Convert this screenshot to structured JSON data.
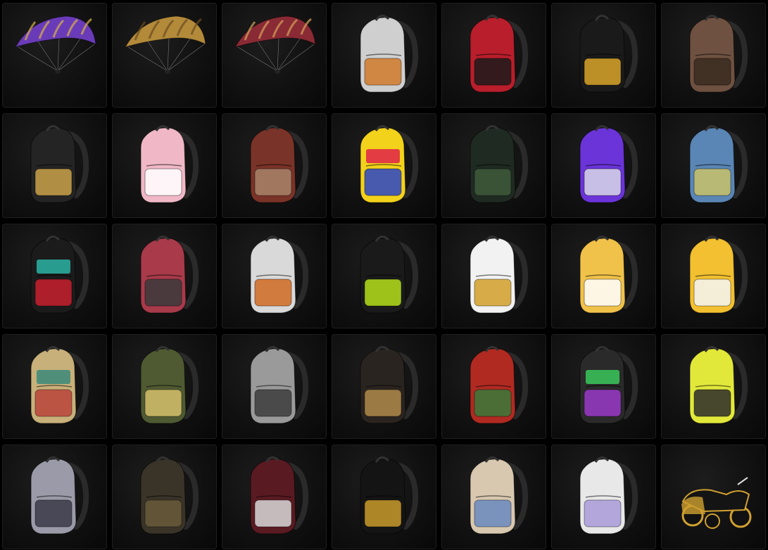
{
  "inventory": {
    "items": [
      {
        "id": "purple-parachute",
        "kind": "parachute",
        "colors": [
          "#6a3bb8",
          "#d8b24a"
        ]
      },
      {
        "id": "gold-scar-parachute",
        "kind": "parachute",
        "colors": [
          "#b28a3a",
          "#6b4b1f"
        ]
      },
      {
        "id": "crimson-pattern-parachute",
        "kind": "parachute",
        "colors": [
          "#8a2a35",
          "#d6a35a"
        ]
      },
      {
        "id": "white-tactical-backpack",
        "kind": "backpack",
        "colors": [
          "#cfcfcf",
          "#d07a2a"
        ]
      },
      {
        "id": "red-sticker-backpack",
        "kind": "backpack",
        "colors": [
          "#b81e2b",
          "#1b1b1b"
        ]
      },
      {
        "id": "black-gold-backpack",
        "kind": "backpack",
        "colors": [
          "#1a1a1a",
          "#d9a52a"
        ]
      },
      {
        "id": "brown-leather-backpack",
        "kind": "backpack",
        "colors": [
          "#6e5140",
          "#3a2a20"
        ]
      },
      {
        "id": "black-v-backpack",
        "kind": "backpack",
        "colors": [
          "#242424",
          "#c9a24a"
        ]
      },
      {
        "id": "pink-bunny-backpack",
        "kind": "backpack",
        "colors": [
          "#f0b8c6",
          "#ffffff"
        ]
      },
      {
        "id": "maroon-tactical-backpack",
        "kind": "backpack",
        "colors": [
          "#7a3328",
          "#a8846a"
        ]
      },
      {
        "id": "just-vibing-backpack",
        "kind": "backpack",
        "colors": [
          "#f2d21b",
          "#2a45c8",
          "#e0234a"
        ]
      },
      {
        "id": "dark-mesh-backpack",
        "kind": "backpack",
        "colors": [
          "#1f2a22",
          "#3f5a3a"
        ]
      },
      {
        "id": "purple-hex-backpack",
        "kind": "backpack",
        "colors": [
          "#6b34d9",
          "#d8d8e8"
        ]
      },
      {
        "id": "blue-camo-backpack",
        "kind": "backpack",
        "colors": [
          "#5a86b5",
          "#c8c26a"
        ]
      },
      {
        "id": "graffiti-pubg-backpack",
        "kind": "backpack",
        "colors": [
          "#1b1b1b",
          "#c5202e",
          "#2ab3a3"
        ]
      },
      {
        "id": "plaid-gnome-backpack",
        "kind": "backpack",
        "colors": [
          "#a83a4a",
          "#3b3b3b"
        ]
      },
      {
        "id": "white-orange-tactical-backpack",
        "kind": "backpack",
        "colors": [
          "#d9d9d9",
          "#d06a22"
        ]
      },
      {
        "id": "black-lime-backpack",
        "kind": "backpack",
        "colors": [
          "#1a1a1a",
          "#b6e01a"
        ]
      },
      {
        "id": "white-gold-stripe-backpack",
        "kind": "backpack",
        "colors": [
          "#f2f2f2",
          "#d2a02a"
        ]
      },
      {
        "id": "yellow-chevron-backpack",
        "kind": "backpack",
        "colors": [
          "#f0c24a",
          "#ffffff"
        ]
      },
      {
        "id": "yellow-chick-backpack",
        "kind": "backpack",
        "colors": [
          "#f2c030",
          "#f5f5f5"
        ]
      },
      {
        "id": "aztec-pattern-backpack",
        "kind": "backpack",
        "colors": [
          "#c8b07a",
          "#b8443a",
          "#3a8a7a"
        ]
      },
      {
        "id": "green-military-backpack",
        "kind": "backpack",
        "colors": [
          "#4f5a32",
          "#d4c06a"
        ]
      },
      {
        "id": "grey-camo-backpack",
        "kind": "backpack",
        "colors": [
          "#9a9a9a",
          "#3c3c3c"
        ]
      },
      {
        "id": "black-leather-gold-backpack",
        "kind": "backpack",
        "colors": [
          "#2a2420",
          "#b08a4a"
        ]
      },
      {
        "id": "red-tartan-backpack",
        "kind": "backpack",
        "colors": [
          "#b02a22",
          "#3a7a3a"
        ]
      },
      {
        "id": "comic-graffiti-backpack",
        "kind": "backpack",
        "colors": [
          "#2a2a2a",
          "#9a3ac8",
          "#3ac85a"
        ]
      },
      {
        "id": "neon-yellow-camo-backpack",
        "kind": "backpack",
        "colors": [
          "#e2e83a",
          "#2a2a2a"
        ]
      },
      {
        "id": "silver-sequin-backpack",
        "kind": "backpack",
        "colors": [
          "#9a9aa8",
          "#3a3a48"
        ]
      },
      {
        "id": "woodland-camo-backpack",
        "kind": "backpack",
        "colors": [
          "#3a3428",
          "#6a5a3a"
        ]
      },
      {
        "id": "skeleton-backpack",
        "kind": "backpack",
        "colors": [
          "#5a1a22",
          "#d8d8d8"
        ]
      },
      {
        "id": "black-gold-hex-backpack",
        "kind": "backpack",
        "colors": [
          "#141414",
          "#c89a2a"
        ]
      },
      {
        "id": "woven-bucket-bag",
        "kind": "backpack",
        "colors": [
          "#d8c8b0",
          "#6a8ac0"
        ]
      },
      {
        "id": "white-lavender-backpack",
        "kind": "backpack",
        "colors": [
          "#e8e8e8",
          "#a89ad8"
        ]
      },
      {
        "id": "gold-sidecar-motorcycle",
        "kind": "vehicle",
        "colors": [
          "#141414",
          "#d0a030"
        ]
      }
    ]
  }
}
